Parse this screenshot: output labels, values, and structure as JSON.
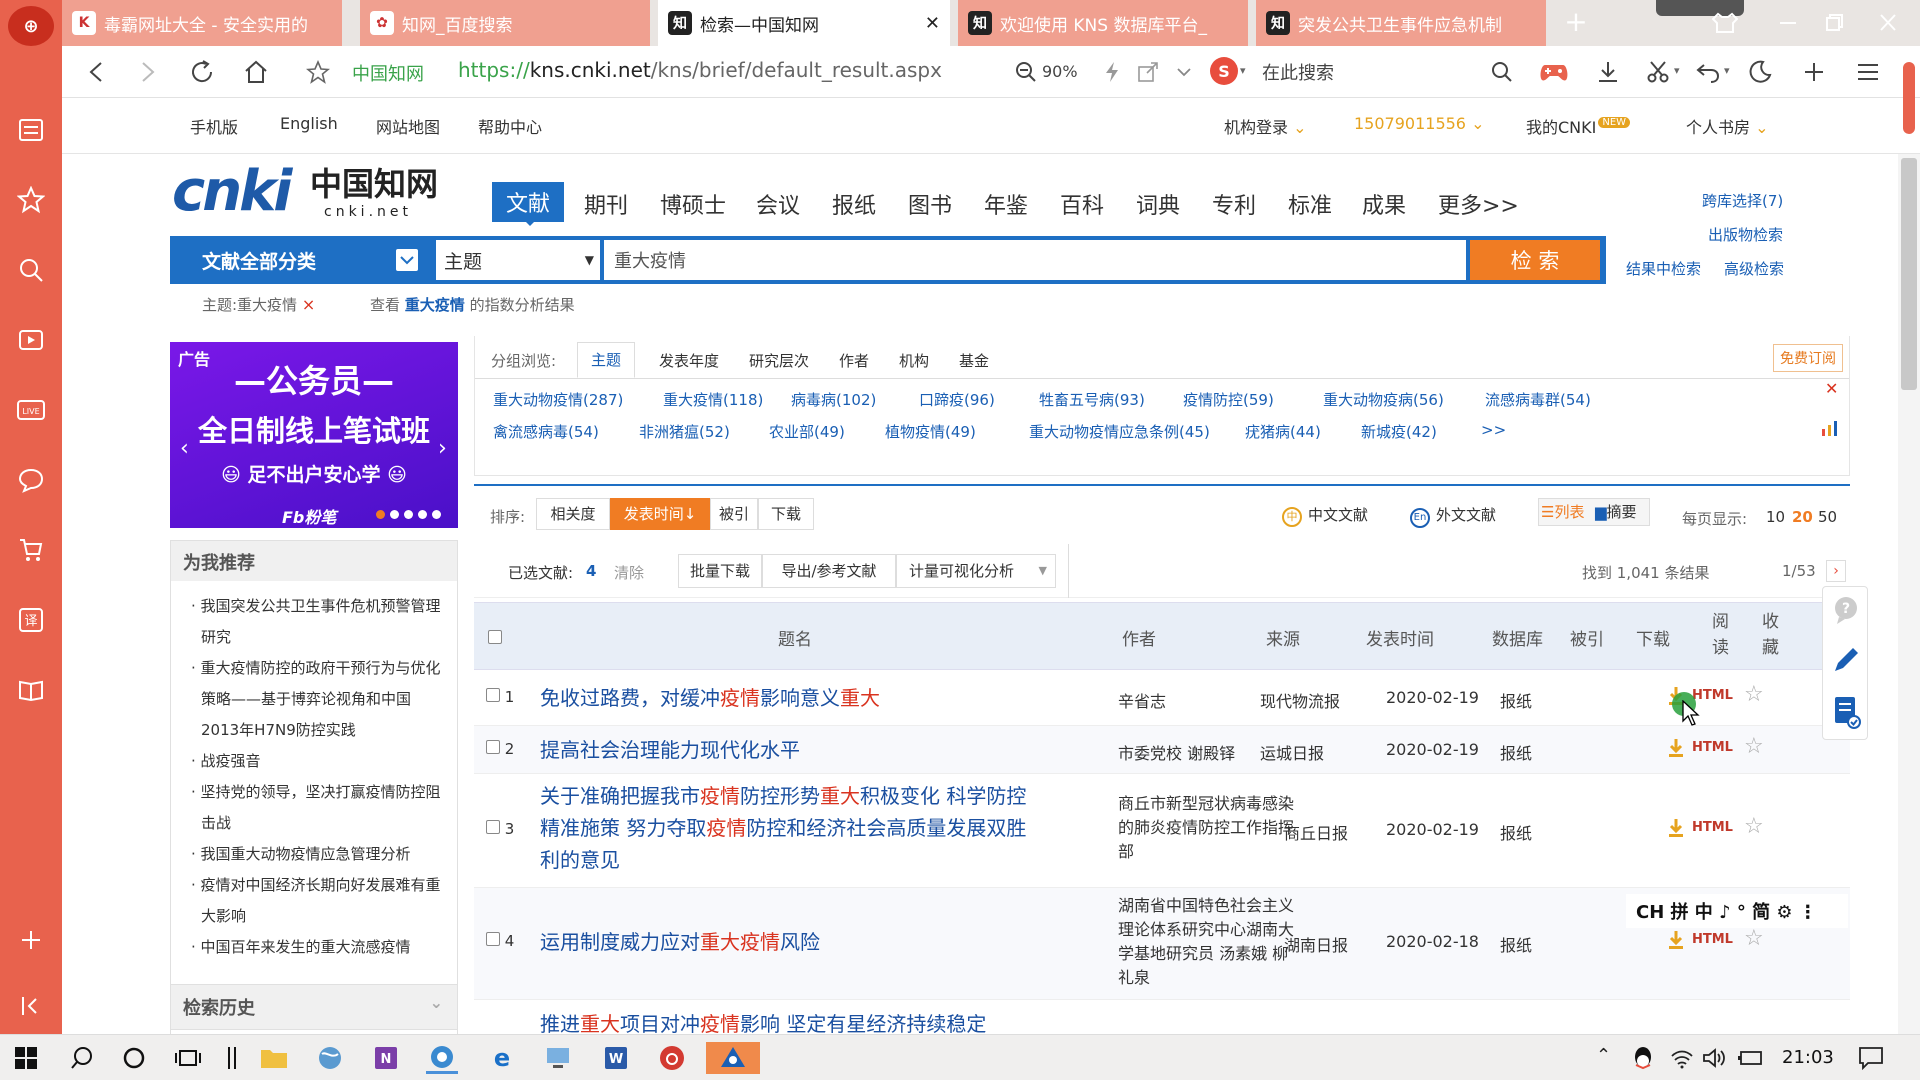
{
  "tabs": [
    {
      "label": "毒霸网址大全 - 安全实用的",
      "fav": "K",
      "state": "inactive"
    },
    {
      "label": "知网_百度搜索",
      "fav": "✿",
      "state": "inactive"
    },
    {
      "label": "检索—中国知网",
      "fav": "知",
      "state": "active"
    },
    {
      "label": "欢迎使用 KNS 数据库平台_",
      "fav": "知",
      "state": "inactive"
    },
    {
      "label": "突发公共卫生事件应急机制",
      "fav": "知",
      "state": "inactive"
    }
  ],
  "tab_close": "✕",
  "new_tab": "+",
  "address": {
    "site_label": "中国知网",
    "url_prefix": "https://",
    "url_host": "kns.cnki.net",
    "url_path": "/kns/brief/default_result.aspx",
    "zoom": "90%",
    "search_placeholder": "在此搜索"
  },
  "toplinks": {
    "mobile": "手机版",
    "english": "English",
    "sitemap": "网站地图",
    "help": "帮助中心",
    "org_login": "机构登录",
    "phone": "15079011556",
    "my_cnki": "我的CNKI",
    "new_badge": "NEW",
    "personal": "个人书房"
  },
  "logo": {
    "main": "cnki",
    "cn": "中国知网",
    "sub": "cnki.net"
  },
  "nav": [
    "文献",
    "期刊",
    "博硕士",
    "会议",
    "报纸",
    "图书",
    "年鉴",
    "百科",
    "词典",
    "专利",
    "标准",
    "成果",
    "更多>>"
  ],
  "right_links": {
    "cross": "跨库选择(7)",
    "pub": "出版物检索",
    "in_result": "结果中检索",
    "advanced": "高级检索"
  },
  "search": {
    "category": "文献全部分类",
    "field": "主题",
    "query": "重大疫情",
    "button": "检 索"
  },
  "filter": {
    "tag": "主题:重大疫情",
    "hint_prefix": "查看",
    "hint_term": "重大疫情",
    "hint_suffix": "的指数分析结果"
  },
  "ad": {
    "label": "广告",
    "line1": "—公务员—",
    "line2": "全日制线上笔试班",
    "line3": "😃 足不出户安心学 😃",
    "brand": "Fb粉笔"
  },
  "recommend": {
    "title": "为我推荐",
    "items": [
      "我国突发公共卫生事件危机预警管理研究",
      "重大疫情防控的政府干预行为与优化策略——基于博弈论视角和中国2013年H7N9防控实践",
      "战疫强音",
      "坚持党的领导，坚决打赢疫情防控阻击战",
      "我国重大动物疫情应急管理分析",
      "疫情对中国经济长期向好发展难有重大影响",
      "中国百年来发生的重大流感疫情"
    ]
  },
  "history": {
    "title": "检索历史"
  },
  "group": {
    "label": "分组浏览:",
    "tabs": [
      "主题",
      "发表年度",
      "研究层次",
      "作者",
      "机构",
      "基金"
    ],
    "subscribe": "免费订阅",
    "row1": [
      "重大动物疫情(287)",
      "重大疫情(118)",
      "病毒病(102)",
      "口蹄疫(96)",
      "牲畜五号病(93)",
      "疫情防控(59)",
      "重大动物疫病(56)",
      "流感病毒群(54)"
    ],
    "row2": [
      "禽流感病毒(54)",
      "非洲猪瘟(52)",
      "农业部(49)",
      "植物疫情(49)",
      "重大动物疫情应急条例(45)",
      "疣猪病(44)",
      "新城疫(42)"
    ],
    "more": ">>"
  },
  "sort": {
    "label": "排序:",
    "options": [
      "相关度",
      "发表时间↓",
      "被引",
      "下载"
    ],
    "cn": "中文文献",
    "en": "外文文献",
    "list": "列表",
    "abstract": "摘要",
    "per_page": "每页显示:",
    "per": [
      "10",
      "20",
      "50"
    ]
  },
  "actions": {
    "selected_label": "已选文献:",
    "selected_count": "4",
    "clear": "清除",
    "batch": "批量下载",
    "export": "导出/参考文献",
    "visual": "计量可视化分析",
    "found": "找到 1,041 条结果",
    "page": "1/53"
  },
  "table": {
    "headers": {
      "title": "题名",
      "author": "作者",
      "source": "来源",
      "date": "发表时间",
      "db": "数据库",
      "cited": "被引",
      "download": "下载",
      "read": "阅读",
      "fav": "收藏"
    },
    "html_label": "HTML",
    "rows": [
      {
        "no": "1",
        "title_parts": [
          [
            "免收过路费，对缓冲",
            0
          ],
          [
            "疫情",
            1
          ],
          [
            "影响意义",
            0
          ],
          [
            "重大",
            1
          ]
        ],
        "author": "辛省志",
        "source": "现代物流报",
        "date": "2020-02-19",
        "db": "报纸"
      },
      {
        "no": "2",
        "title_parts": [
          [
            "提高社会治理能力现代化水平",
            0
          ]
        ],
        "author": "市委党校 谢殿铎",
        "source": "运城日报",
        "date": "2020-02-19",
        "db": "报纸"
      },
      {
        "no": "3",
        "title_parts": [
          [
            "关于准确把握我市",
            0
          ],
          [
            "疫情",
            1
          ],
          [
            "防控形势",
            0
          ],
          [
            "重大",
            1
          ],
          [
            "积极变化 科学防控 精准施策 努力夺取",
            0
          ],
          [
            "疫情",
            1
          ],
          [
            "防控和经济社会高质量发展双胜利的意见",
            0
          ]
        ],
        "author": "商丘市新型冠状病毒感染的肺炎疫情防控工作指挥部",
        "source": "商丘日报",
        "date": "2020-02-19",
        "db": "报纸"
      },
      {
        "no": "4",
        "title_parts": [
          [
            "运用制度威力应对",
            0
          ],
          [
            "重大疫情",
            1
          ],
          [
            "风险",
            0
          ]
        ],
        "author": "湖南省中国特色社会主义理论体系研究中心湖南大学基地研究员 汤素娥 柳礼泉",
        "source": "湖南日报",
        "date": "2020-02-18",
        "db": "报纸"
      },
      {
        "no": "5",
        "title_parts": [
          [
            "推进",
            0
          ],
          [
            "重大",
            1
          ],
          [
            "项目对冲",
            0
          ],
          [
            "疫情",
            1
          ],
          [
            "影响 坚定有星经济持续稳定",
            0
          ]
        ],
        "author": "",
        "source": "",
        "date": "",
        "db": ""
      }
    ]
  },
  "ime": "CH 拼 中 ♪ ° 简 ⚙ ⋮",
  "taskbar": {
    "time": "21:03"
  }
}
